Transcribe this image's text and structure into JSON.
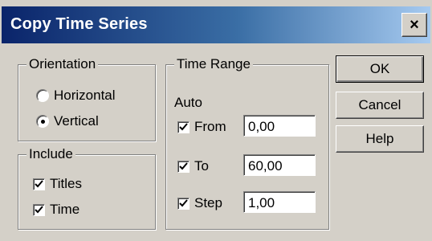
{
  "window": {
    "title": "Copy Time Series",
    "close_glyph": "×"
  },
  "orientation": {
    "label": "Orientation",
    "options": [
      {
        "label": "Horizontal",
        "selected": false
      },
      {
        "label": "Vertical",
        "selected": true
      }
    ]
  },
  "include": {
    "label": "Include",
    "options": [
      {
        "label": "Titles",
        "checked": true
      },
      {
        "label": "Time",
        "checked": true
      }
    ]
  },
  "time_range": {
    "label": "Time Range",
    "auto_label": "Auto",
    "fields": [
      {
        "label": "From",
        "checked": true,
        "value": "0,00"
      },
      {
        "label": "To",
        "checked": true,
        "value": "60,00"
      },
      {
        "label": "Step",
        "checked": true,
        "value": "1,00"
      }
    ]
  },
  "buttons": {
    "ok": "OK",
    "cancel": "Cancel",
    "help": "Help"
  },
  "colors": {
    "face": "#d4d0c8",
    "title_start": "#0a246a",
    "title_end": "#a6caf0"
  }
}
